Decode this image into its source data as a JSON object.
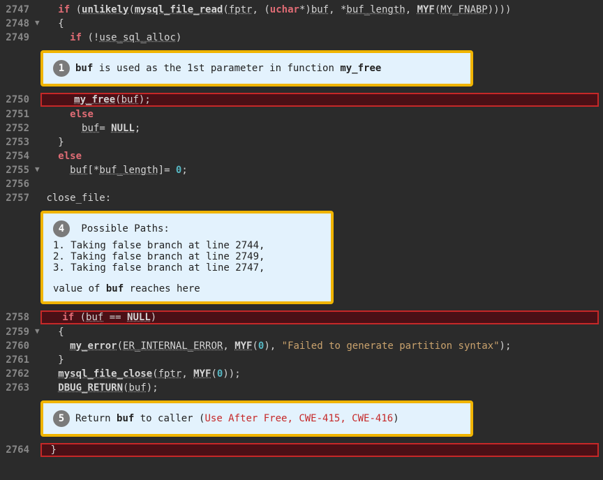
{
  "lines": {
    "l2747": {
      "num": "2747"
    },
    "l2748": {
      "num": "2748"
    },
    "l2749": {
      "num": "2749"
    },
    "l2750": {
      "num": "2750"
    },
    "l2751": {
      "num": "2751"
    },
    "l2752": {
      "num": "2752"
    },
    "l2753": {
      "num": "2753"
    },
    "l2754": {
      "num": "2754"
    },
    "l2755": {
      "num": "2755"
    },
    "l2756": {
      "num": "2756"
    },
    "l2757": {
      "num": "2757"
    },
    "l2758": {
      "num": "2758"
    },
    "l2759": {
      "num": "2759"
    },
    "l2760": {
      "num": "2760"
    },
    "l2761": {
      "num": "2761"
    },
    "l2762": {
      "num": "2762"
    },
    "l2763": {
      "num": "2763"
    },
    "l2764": {
      "num": "2764"
    }
  },
  "tokens": {
    "if": "if",
    "else": "else",
    "unlikely": "unlikely",
    "mysql_file_read": "mysql_file_read",
    "fptr": "fptr",
    "uchar": "uchar",
    "buf": "buf",
    "buf_length": "buf_length",
    "MYF": "MYF",
    "MY_FNABP": "MY_FNABP",
    "use_sql_alloc": "use_sql_alloc",
    "my_free": "my_free",
    "NULL": "NULL",
    "zero": "0",
    "close_file": "close_file:",
    "eq": "==",
    "my_error": "my_error",
    "ER_INTERNAL_ERROR": "ER_INTERNAL_ERROR",
    "err_str": "\"Failed to generate partition syntax\"",
    "mysql_file_close": "mysql_file_close",
    "DBUG_RETURN": "DBUG_RETURN",
    "lbrace": "{",
    "rbrace": "}",
    "lparen": "(",
    "rparen": ")",
    "star": "*",
    "bang": "!",
    "semi": ";",
    "comma": ", ",
    "assign": "= ",
    "lbrack": "[",
    "rbrack": "]"
  },
  "callouts": {
    "c1": {
      "num": "1",
      "pre": "buf",
      "mid": " is used as the 1st parameter in function ",
      "post": "my_free"
    },
    "c4": {
      "num": "4",
      "title": " Possible Paths:",
      "p1": "1. Taking false branch at line 2744,",
      "p2": "2. Taking false branch at line 2749,",
      "p3": "3. Taking false branch at line 2747,",
      "footer_pre": "value of ",
      "footer_b": "buf",
      "footer_post": " reaches here"
    },
    "c5": {
      "num": "5",
      "pre": "Return ",
      "b": "buf",
      "mid": " to caller (",
      "red": "Use After Free, CWE-415, CWE-416",
      "post": ")"
    }
  }
}
